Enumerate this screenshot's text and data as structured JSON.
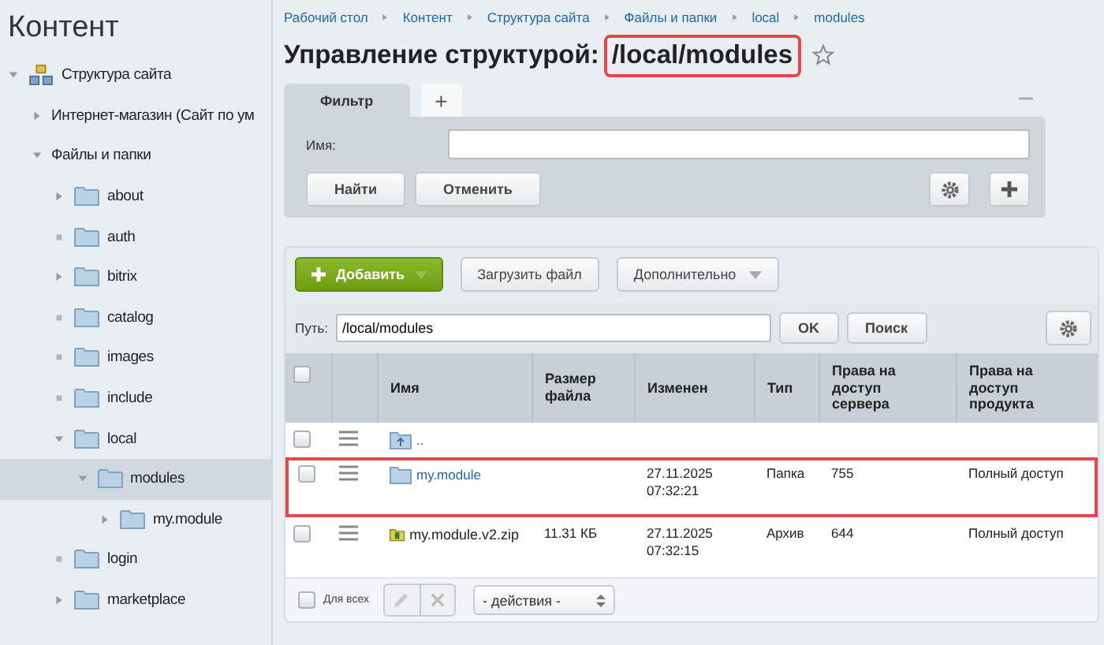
{
  "sidebar": {
    "title": "Контент",
    "tree": [
      {
        "label": "Структура сайта",
        "kind": "branch",
        "expanded": true,
        "selected": false,
        "children": [
          {
            "label": "Интернет-магазин (Сайт по ум",
            "kind": "branch",
            "expanded": false,
            "selected": false
          },
          {
            "label": "Файлы и папки",
            "kind": "branch",
            "expanded": true,
            "selected": false,
            "children": [
              {
                "label": "about",
                "kind": "branch",
                "expanded": false,
                "selected": false
              },
              {
                "label": "auth",
                "kind": "leaf",
                "selected": false
              },
              {
                "label": "bitrix",
                "kind": "branch",
                "expanded": false,
                "selected": false
              },
              {
                "label": "catalog",
                "kind": "leaf",
                "selected": false
              },
              {
                "label": "images",
                "kind": "leaf",
                "selected": false
              },
              {
                "label": "include",
                "kind": "leaf",
                "selected": false
              },
              {
                "label": "local",
                "kind": "branch",
                "expanded": true,
                "selected": false,
                "children": [
                  {
                    "label": "modules",
                    "kind": "branch",
                    "expanded": true,
                    "selected": true,
                    "children": [
                      {
                        "label": "my.module",
                        "kind": "branch",
                        "expanded": false,
                        "selected": false
                      }
                    ]
                  }
                ]
              },
              {
                "label": "login",
                "kind": "leaf",
                "selected": false
              },
              {
                "label": "marketplace",
                "kind": "branch",
                "expanded": false,
                "selected": false
              }
            ]
          }
        ]
      }
    ]
  },
  "breadcrumbs": [
    "Рабочий стол",
    "Контент",
    "Структура сайта",
    "Файлы и папки",
    "local",
    "modules"
  ],
  "title": {
    "prefix": "Управление структурой:",
    "path": "/local/modules",
    "path_highlighted": true,
    "starred": false
  },
  "filter": {
    "tabs": [
      {
        "label": "Фильтр",
        "selected": true
      },
      {
        "label": "+",
        "selected": false
      }
    ],
    "field_label": "Имя:",
    "buttons": [
      "Найти",
      "Отменить"
    ]
  },
  "toolbar": {
    "add": "Добавить",
    "upload": "Загрузить файл",
    "more": "Дополнительно"
  },
  "path": {
    "label": "Путь:",
    "value": "/local/modules",
    "ok": "OK",
    "search": "Поиск"
  },
  "table": {
    "select_all_checked": false,
    "columns": [
      "Имя",
      "Размер файла",
      "Изменен",
      "Тип",
      "Права на доступ сервера",
      "Права на доступ продукта"
    ],
    "rows": [
      {
        "kind": "up",
        "name": "..",
        "checked": false,
        "highlighted": false
      },
      {
        "kind": "folder",
        "name": "my.module",
        "size": "",
        "modified": "27.11.2025 07:32:21",
        "type": "Папка",
        "server": "755",
        "product": "Полный доступ",
        "checked": false,
        "highlighted": true
      },
      {
        "kind": "archive",
        "name": "my.module.v2.zip",
        "size": "11.31 КБ",
        "modified": "27.11.2025 07:32:15",
        "type": "Архив",
        "server": "644",
        "product": "Полный доступ",
        "checked": false,
        "highlighted": false
      }
    ]
  },
  "footer": {
    "all_label": "Для всех",
    "all_checked": false,
    "actions": "- действия -"
  }
}
